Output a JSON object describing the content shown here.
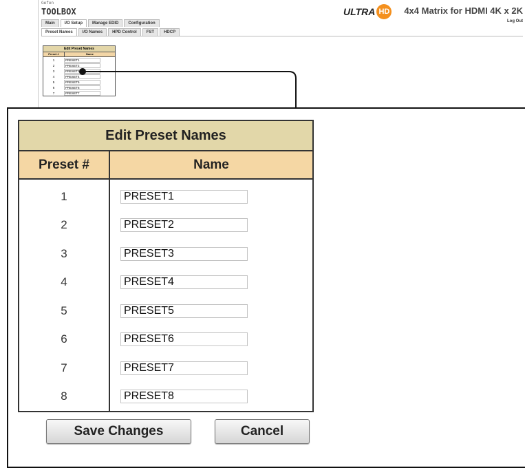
{
  "app": {
    "brand_small": "Gefen",
    "brand_big": "TOOLBOX",
    "ultra_text": "ULTRA",
    "hd_text": "HD",
    "title": "4x4 Matrix for HDMI 4K x 2K",
    "logout": "Log Out"
  },
  "tabs": [
    "Main",
    "I/O Setup",
    "Manage EDID",
    "Configuration"
  ],
  "subtabs": [
    "Preset Names",
    "I/O Names",
    "HPD Control",
    "FST",
    "HDCP"
  ],
  "preset_table": {
    "title": "Edit Preset Names",
    "col_num": "Preset #",
    "col_name": "Name",
    "rows": [
      {
        "num": "1",
        "name": "PRESET1"
      },
      {
        "num": "2",
        "name": "PRESET2"
      },
      {
        "num": "3",
        "name": "PRESET3"
      },
      {
        "num": "4",
        "name": "PRESET4"
      },
      {
        "num": "5",
        "name": "PRESET5"
      },
      {
        "num": "6",
        "name": "PRESET6"
      },
      {
        "num": "7",
        "name": "PRESET7"
      },
      {
        "num": "8",
        "name": "PRESET8"
      }
    ]
  },
  "buttons": {
    "save": "Save Changes",
    "cancel": "Cancel"
  },
  "colors": {
    "title_bg": "#e2d7a9",
    "header_bg": "#f5d7a4",
    "hd_orange": "#f4901e"
  }
}
